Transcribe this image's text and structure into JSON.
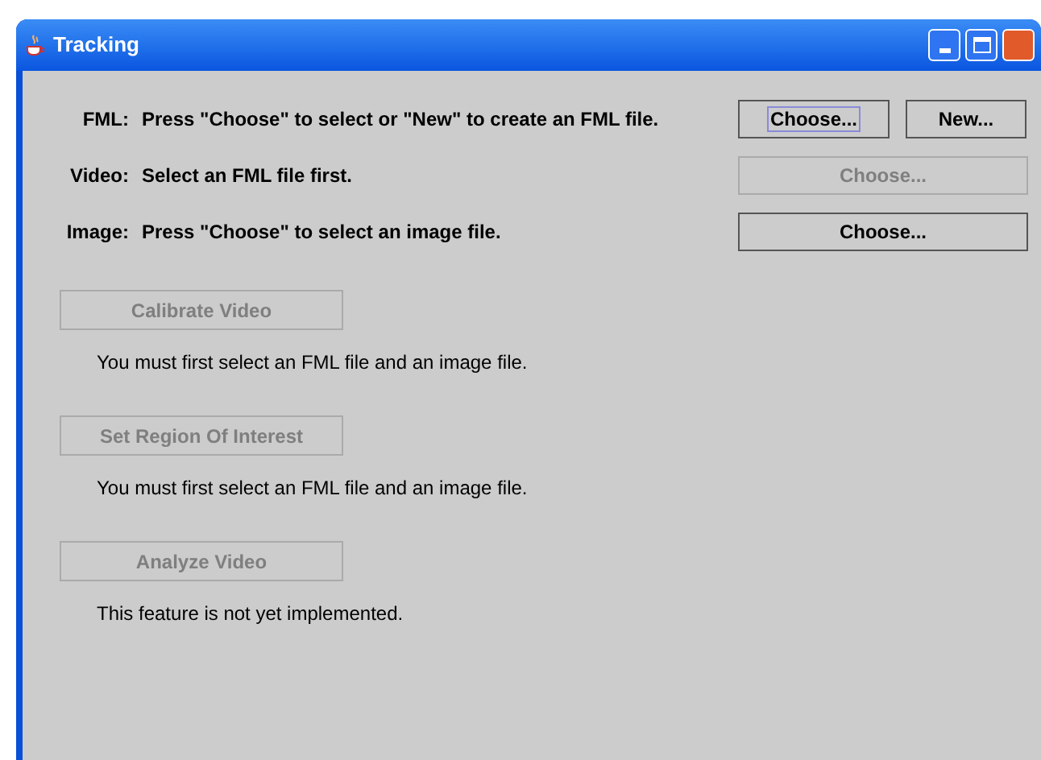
{
  "window": {
    "title": "Tracking"
  },
  "file_rows": [
    {
      "label": "FML:",
      "message": "Press \"Choose\" to select or \"New\" to create an FML file.",
      "buttons": [
        {
          "label": "Choose...",
          "disabled": false,
          "focused": true
        },
        {
          "label": "New...",
          "disabled": false,
          "focused": false
        }
      ]
    },
    {
      "label": "Video:",
      "message": "Select an FML file first.",
      "buttons": [
        {
          "label": "Choose...",
          "disabled": true,
          "focused": false
        }
      ]
    },
    {
      "label": "Image:",
      "message": "Press \"Choose\" to select an image file.",
      "buttons": [
        {
          "label": "Choose...",
          "disabled": false,
          "focused": false
        }
      ]
    }
  ],
  "actions": [
    {
      "label": "Calibrate Video",
      "disabled": true,
      "message": "You must first select an FML file and an image file."
    },
    {
      "label": "Set Region Of Interest",
      "disabled": true,
      "message": "You must first select an FML file and an image file."
    },
    {
      "label": "Analyze Video",
      "disabled": true,
      "message": "This feature is not yet implemented."
    }
  ]
}
